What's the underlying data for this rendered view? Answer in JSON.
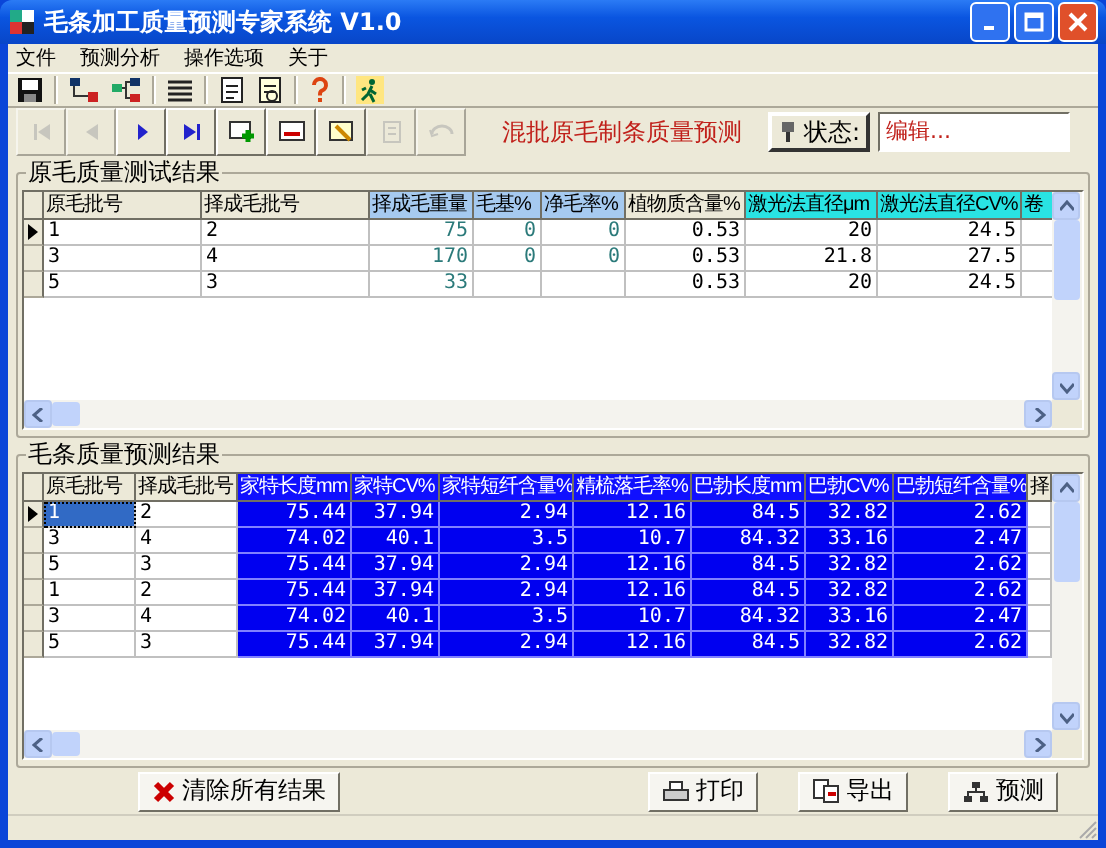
{
  "window": {
    "title": "毛条加工质量预测专家系统  V1.0"
  },
  "menu": [
    {
      "label": "文件"
    },
    {
      "label": "预测分析"
    },
    {
      "label": "操作选项"
    },
    {
      "label": "关于"
    }
  ],
  "toolbar": [
    {
      "kind": "save"
    },
    {
      "kind": "separator"
    },
    {
      "kind": "link"
    },
    {
      "kind": "link-alt"
    },
    {
      "kind": "separator"
    },
    {
      "kind": "list"
    },
    {
      "kind": "separator"
    },
    {
      "kind": "doc"
    },
    {
      "kind": "doc-edit"
    },
    {
      "kind": "separator"
    },
    {
      "kind": "help"
    },
    {
      "kind": "separator"
    },
    {
      "kind": "run"
    }
  ],
  "nav_buttons": [
    {
      "kind": "first",
      "disabled": true
    },
    {
      "kind": "prev",
      "disabled": true
    },
    {
      "kind": "next",
      "disabled": false
    },
    {
      "kind": "last",
      "disabled": false
    },
    {
      "kind": "insert",
      "disabled": false
    },
    {
      "kind": "delete",
      "disabled": false
    },
    {
      "kind": "edit",
      "disabled": false
    },
    {
      "kind": "post",
      "disabled": true
    },
    {
      "kind": "cancel",
      "disabled": true
    }
  ],
  "heading": "混批原毛制条质量预测",
  "status": {
    "label": "状态:",
    "value": "编辑..."
  },
  "raw_group": {
    "title": "原毛质量测试结果",
    "focused": false,
    "columns": [
      {
        "label": "原毛批号",
        "kind": "key"
      },
      {
        "label": "择成毛批号",
        "kind": "key"
      },
      {
        "label": "择成毛重量",
        "kind": "input"
      },
      {
        "label": "毛基%",
        "kind": "input"
      },
      {
        "label": "净毛率%",
        "kind": "input"
      },
      {
        "label": "植物质含量%",
        "kind": "plain"
      },
      {
        "label": "激光法直径μm",
        "kind": "laser"
      },
      {
        "label": "激光法直径CV%",
        "kind": "laser"
      },
      {
        "label": "卷",
        "kind": "laser"
      }
    ],
    "rows": [
      {
        "current": true,
        "cells": [
          "1",
          "2",
          "75",
          "0",
          "0",
          "0.53",
          "20",
          "24.5",
          null
        ]
      },
      {
        "current": false,
        "cells": [
          "3",
          "4",
          "170",
          "0",
          "0",
          "0.53",
          "21.8",
          "27.5",
          null
        ]
      },
      {
        "current": false,
        "cells": [
          "5",
          "3",
          "33",
          null,
          null,
          "0.53",
          "20",
          "24.5",
          null
        ]
      }
    ]
  },
  "pred_group": {
    "title": "毛条质量预测结果",
    "focused": true,
    "columns": [
      {
        "label": "原毛批号",
        "kind": "key"
      },
      {
        "label": "择成毛批号",
        "kind": "key"
      },
      {
        "label": "家特长度mm",
        "kind": "predicted"
      },
      {
        "label": "家特CV%",
        "kind": "predicted"
      },
      {
        "label": "家特短纤含量%",
        "kind": "predicted"
      },
      {
        "label": "精梳落毛率%",
        "kind": "predicted"
      },
      {
        "label": "巴勃长度mm",
        "kind": "predicted"
      },
      {
        "label": "巴勃CV%",
        "kind": "predicted"
      },
      {
        "label": "巴勃短纤含量%",
        "kind": "predicted"
      },
      {
        "label": "择",
        "kind": "key"
      }
    ],
    "rows": [
      {
        "current": true,
        "cells": [
          "1",
          "2",
          "75.44",
          "37.94",
          "2.94",
          "12.16",
          "84.5",
          "32.82",
          "2.62",
          null
        ]
      },
      {
        "current": false,
        "cells": [
          "3",
          "4",
          "74.02",
          "40.1",
          "3.5",
          "10.7",
          "84.32",
          "33.16",
          "2.47",
          null
        ]
      },
      {
        "current": false,
        "cells": [
          "5",
          "3",
          "75.44",
          "37.94",
          "2.94",
          "12.16",
          "84.5",
          "32.82",
          "2.62",
          null
        ]
      },
      {
        "current": false,
        "cells": [
          "1",
          "2",
          "75.44",
          "37.94",
          "2.94",
          "12.16",
          "84.5",
          "32.82",
          "2.62",
          null
        ]
      },
      {
        "current": false,
        "cells": [
          "3",
          "4",
          "74.02",
          "40.1",
          "3.5",
          "10.7",
          "84.32",
          "33.16",
          "2.47",
          null
        ]
      },
      {
        "current": false,
        "cells": [
          "5",
          "3",
          "75.44",
          "37.94",
          "2.94",
          "12.16",
          "84.5",
          "32.82",
          "2.62",
          null
        ]
      }
    ]
  },
  "buttons": [
    {
      "label": "清除所有结果",
      "kind": "clear"
    },
    {
      "label": "打印",
      "kind": "print"
    },
    {
      "label": "导出",
      "kind": "export"
    },
    {
      "label": "预测",
      "kind": "predict"
    }
  ]
}
